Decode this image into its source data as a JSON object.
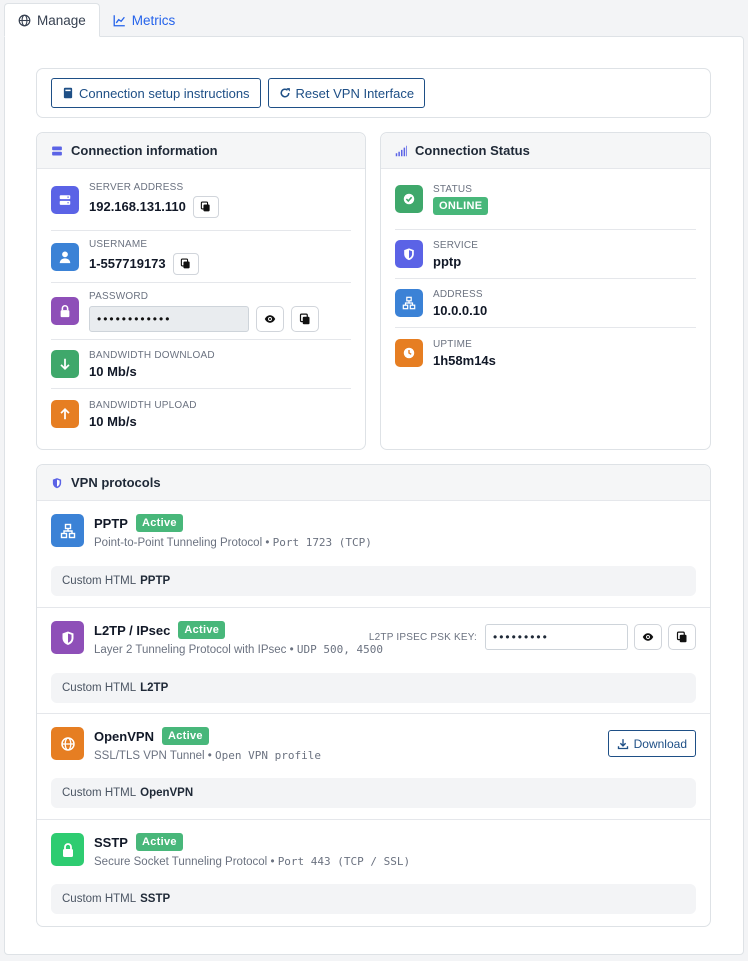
{
  "tabs": [
    {
      "label": "Manage",
      "icon": "globe-icon",
      "active": true
    },
    {
      "label": "Metrics",
      "icon": "chart-line-icon",
      "active": false
    }
  ],
  "toolbar": {
    "setup_label": "Connection setup instructions",
    "reset_label": "Reset VPN Interface"
  },
  "connection_info": {
    "title": "Connection information",
    "server_label": "SERVER ADDRESS",
    "server_value": "192.168.131.110",
    "username_label": "USERNAME",
    "username_value": "1-557719173",
    "password_label": "PASSWORD",
    "password_value": "••••••••••••",
    "bw_down_label": "BANDWIDTH DOWNLOAD",
    "bw_down_value": "10 Mb/s",
    "bw_up_label": "BANDWIDTH UPLOAD",
    "bw_up_value": "10 Mb/s"
  },
  "connection_status": {
    "title": "Connection Status",
    "status_label": "STATUS",
    "status_value": "ONLINE",
    "service_label": "SERVICE",
    "service_value": "pptp",
    "address_label": "ADDRESS",
    "address_value": "10.0.0.10",
    "uptime_label": "UPTIME",
    "uptime_value": "1h58m14s"
  },
  "protocols": {
    "title": "VPN protocols",
    "items": [
      {
        "name": "PPTP",
        "status": "Active",
        "desc": "Point-to-Point Tunneling Protocol",
        "sep": "•",
        "port": "Port 1723 (TCP)",
        "custom_prefix": "Custom HTML",
        "custom_name": "PPTP"
      },
      {
        "name": "L2TP / IPsec",
        "status": "Active",
        "desc": "Layer 2 Tunneling Protocol with IPsec",
        "sep": "•",
        "port": "UDP 500, 4500",
        "custom_prefix": "Custom HTML",
        "custom_name": "L2TP",
        "psk_label": "L2TP IPSEC PSK KEY:",
        "psk_value": "•••••••••"
      },
      {
        "name": "OpenVPN",
        "status": "Active",
        "desc": "SSL/TLS VPN Tunnel",
        "sep": "•",
        "port": "Open VPN profile",
        "custom_prefix": "Custom HTML",
        "custom_name": "OpenVPN",
        "download_label": "Download"
      },
      {
        "name": "SSTP",
        "status": "Active",
        "desc": "Secure Socket Tunneling Protocol",
        "sep": "•",
        "port": "Port 443 (TCP / SSL)",
        "custom_prefix": "Custom HTML",
        "custom_name": "SSTP"
      }
    ]
  },
  "colors": {
    "blue_dark": "#1e4f86",
    "indigo": "#5b63e6",
    "sky": "#3b82d6",
    "purple": "#8e4fb8",
    "green": "#3fa86b",
    "orange": "#e67e22",
    "bright_green": "#2ecc71",
    "badge_green": "#48b77a"
  }
}
